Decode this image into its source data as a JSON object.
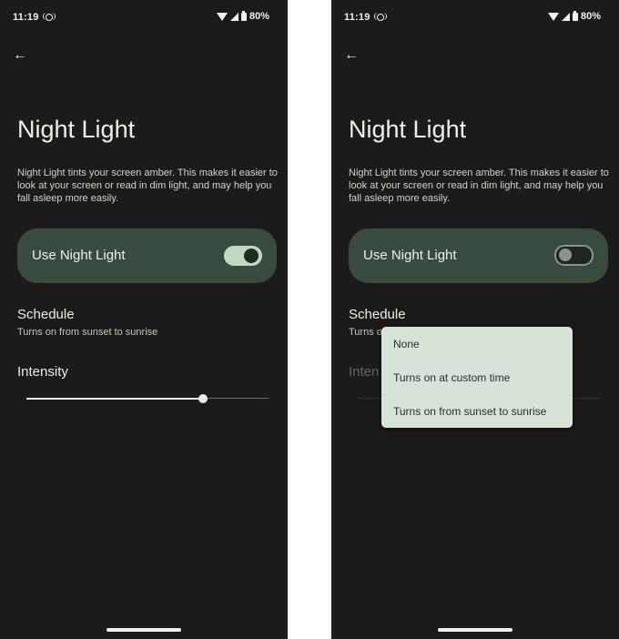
{
  "status_bar": {
    "time": "11:19",
    "battery": "80%"
  },
  "page": {
    "title": "Night Light",
    "description": "Night Light tints your screen amber. This makes it easier to look at your screen or read in dim light, and may help you fall asleep more easily."
  },
  "use_night_light": {
    "label": "Use Night Light"
  },
  "schedule": {
    "title": "Schedule",
    "summary": "Turns on from sunset to sunrise",
    "summary_truncated": "Turns o"
  },
  "intensity": {
    "label": "Intensity",
    "label_truncated": "Inten",
    "value": 0.73
  },
  "left_screen": {
    "night_light_on": true
  },
  "right_screen": {
    "night_light_on": false,
    "dropdown_options": [
      "None",
      "Turns on at custom time",
      "Turns on from sunset to sunrise"
    ]
  },
  "icons": {
    "back": "arrow-left-icon",
    "cast": "cast-icon",
    "wifi": "wifi-icon",
    "signal": "signal-icon",
    "battery": "battery-icon"
  },
  "colors": {
    "background": "#1c1b19",
    "card": "#394a3e",
    "switch_on": "#c3d7c3",
    "menu": "#d6e3d6"
  }
}
